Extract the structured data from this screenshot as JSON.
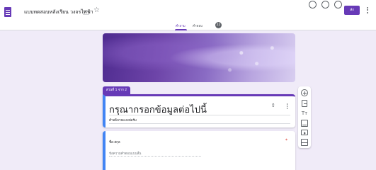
{
  "app": {
    "icon": "google-forms-icon",
    "document_title": "แบบทดสอบหลังเรียน วงจรไฟฟ้า",
    "accent_color": "#673ab7",
    "background_color": "#f0ebf8"
  },
  "header_actions": {
    "palette_icon": "palette-icon",
    "preview_icon": "eye-icon",
    "undo_icon": "undo-icon",
    "send_label": "ส่ง",
    "more_icon": "more-vert-icon"
  },
  "tabs": [
    {
      "label": "คำถาม",
      "active": true
    },
    {
      "label": "คำตอบ",
      "active": false,
      "badge": "22"
    }
  ],
  "section": {
    "label": "ส่วนที่ 1 จาก 2"
  },
  "form_header": {
    "title": "กรุณากรอกข้อมูลต่อไปนี้",
    "description": "คำอธิบายแบบฟอร์ม"
  },
  "question": {
    "title": "ชื่อ-สกุล",
    "required_mark": "*",
    "answer_placeholder": "ข้อความคำตอบแบบสั้น"
  },
  "side_toolbar": [
    "add-question-icon",
    "import-questions-icon",
    "add-title-icon",
    "add-image-icon",
    "add-video-icon",
    "add-section-icon"
  ]
}
